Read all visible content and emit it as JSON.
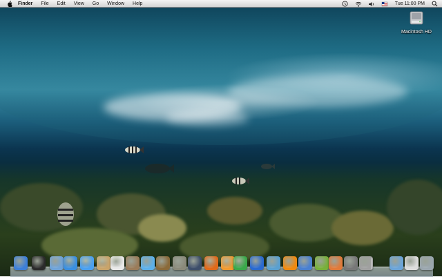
{
  "menubar": {
    "app_name": "Finder",
    "items": [
      "File",
      "Edit",
      "View",
      "Go",
      "Window",
      "Help"
    ],
    "clock": "Tue 11:00 PM",
    "status_icons": [
      "time-machine-icon",
      "wifi-icon",
      "volume-icon",
      "flag-icon"
    ]
  },
  "desktop": {
    "drive_label": "Macintosh HD"
  },
  "dock": {
    "apps": [
      {
        "icon": "finder-icon",
        "color": "#3d7fd8"
      },
      {
        "icon": "dashboard-icon",
        "color": "#2b2b2b"
      },
      {
        "icon": "preview-icon",
        "color": "#6fa3d8"
      },
      {
        "icon": "safari-icon",
        "color": "#3a8fe0"
      },
      {
        "icon": "ichat-icon",
        "color": "#4aa0f0"
      },
      {
        "icon": "address-book-icon",
        "color": "#c9a46a"
      },
      {
        "icon": "ical-icon",
        "color": "#e8e8e8"
      },
      {
        "icon": "photo-icon",
        "color": "#9a7c5a"
      },
      {
        "icon": "itunes-icon",
        "color": "#5cb0ea"
      },
      {
        "icon": "iphoto-icon",
        "color": "#8a6a3a"
      },
      {
        "icon": "system-tool-icon",
        "color": "#8a8a7a"
      },
      {
        "icon": "spaces-icon",
        "color": "#3d4e6a"
      },
      {
        "icon": "firefox-icon",
        "color": "#e06a1a"
      },
      {
        "icon": "transmission-icon",
        "color": "#f09a30"
      },
      {
        "icon": "utorrent-icon",
        "color": "#3aa84a"
      },
      {
        "icon": "browser-globe-icon",
        "color": "#2a6ad0"
      },
      {
        "icon": "people-icon",
        "color": "#5aa0d0"
      },
      {
        "icon": "vlc-icon",
        "color": "#f08a10"
      },
      {
        "icon": "city-icon",
        "color": "#4a80d0"
      },
      {
        "icon": "utility-icon",
        "color": "#78b03a"
      },
      {
        "icon": "scale-icon",
        "color": "#e07a3a"
      },
      {
        "icon": "system-preferences-icon",
        "color": "#777777"
      },
      {
        "icon": "screen-tool-icon",
        "color": "#a0a0a0"
      },
      {
        "icon": "downloads-folder-icon",
        "color": "#6ba4d8"
      },
      {
        "icon": "document-icon",
        "color": "#dcdcdc"
      },
      {
        "icon": "trash-icon",
        "color": "#9aa6ae"
      }
    ]
  }
}
